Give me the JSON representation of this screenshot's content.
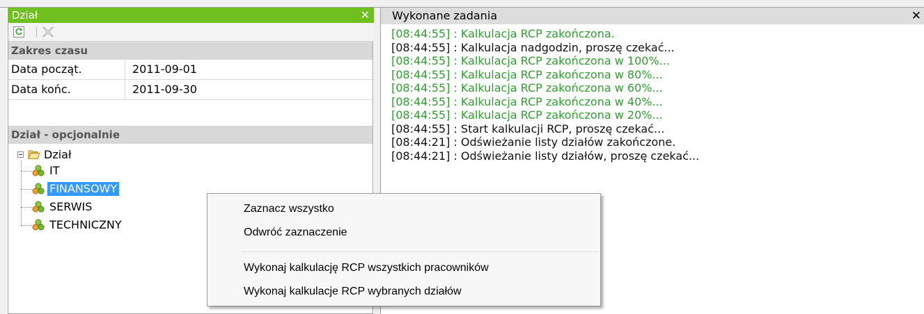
{
  "left_panel": {
    "title": "Dział",
    "close_symbol": "✕",
    "toolbar": {
      "refresh_icon": "refresh-icon",
      "delete_icon": "delete-icon"
    },
    "time_section": {
      "header": "Zakres czasu",
      "rows": [
        {
          "label": "Data począt.",
          "value": "2011-09-01"
        },
        {
          "label": "Data końc.",
          "value": "2011-09-30"
        }
      ]
    },
    "dept_section": {
      "header": "Dział - opcjonalnie",
      "tree": {
        "root": "Dział",
        "items": [
          "IT",
          "FINANSOWY",
          "SERWIS",
          "TECHNICZNY"
        ],
        "selected": "FINANSOWY"
      }
    }
  },
  "right_panel": {
    "title": "Wykonane zadania",
    "close_symbol": "✕",
    "log": [
      {
        "text": "[08:44:55] : Kalkulacja RCP zakończona.",
        "status": "ok"
      },
      {
        "text": "[08:44:55] : Kalkulacja nadgodzin, proszę czekać...",
        "status": "info"
      },
      {
        "text": "[08:44:55] : Kalkulacja RCP zakończona w 100%...",
        "status": "ok"
      },
      {
        "text": "[08:44:55] : Kalkulacja RCP zakończona w 80%...",
        "status": "ok"
      },
      {
        "text": "[08:44:55] : Kalkulacja RCP zakończona w 60%...",
        "status": "ok"
      },
      {
        "text": "[08:44:55] : Kalkulacja RCP zakończona w 40%...",
        "status": "ok"
      },
      {
        "text": "[08:44:55] : Kalkulacja RCP zakończona w 20%...",
        "status": "ok"
      },
      {
        "text": "[08:44:55] : Start kalkulacji RCP, proszę czekać...",
        "status": "info"
      },
      {
        "text": "[08:44:21] : Odświeżanie listy działów zakończone.",
        "status": "info"
      },
      {
        "text": "[08:44:21] : Odświeżanie listy działów, proszę czekać...",
        "status": "info"
      }
    ]
  },
  "context_menu": {
    "items": [
      "Zaznacz wszystko",
      "Odwróć zaznaczenie",
      "Wykonaj kalkulację RCP wszystkich pracowników",
      "Wykonaj kalkulacje RCP wybranych działów"
    ]
  },
  "colors": {
    "title_green": "#6fbf1f",
    "log_ok": "#2f9e2f",
    "selection_blue": "#3399ff",
    "section_gray": "#d8d8d8"
  }
}
